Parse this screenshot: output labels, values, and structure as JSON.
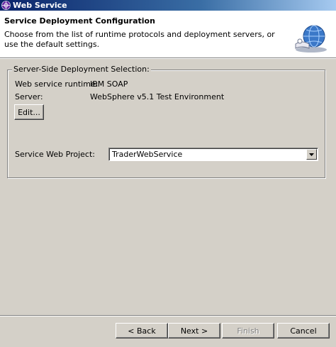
{
  "window": {
    "title": "Web Service"
  },
  "header": {
    "title": "Service Deployment Configuration",
    "description": "Choose from the list of runtime protocols and deployment servers, or use the default settings."
  },
  "group": {
    "legend": "Server-Side Deployment Selection:",
    "runtime_label": "Web service runtime:",
    "runtime_value": "IBM SOAP",
    "server_label": "Server:",
    "server_value": "WebSphere v5.1 Test Environment",
    "edit_button": "Edit..."
  },
  "project": {
    "label": "Service Web Project:",
    "selected": "TraderWebService"
  },
  "buttons": {
    "back": "< Back",
    "next": "Next >",
    "finish": "Finish",
    "cancel": "Cancel"
  },
  "colors": {
    "title_bar": "#0a246a",
    "dialog_bg": "#d4d0c8",
    "header_bg": "#ffffff"
  }
}
